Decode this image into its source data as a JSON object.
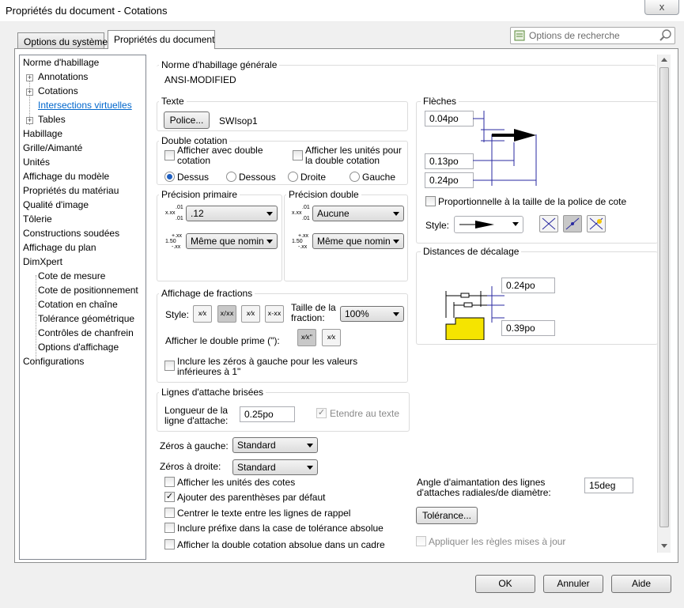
{
  "window": {
    "title": "Propriétés du document - Cotations",
    "close_glyph": "x"
  },
  "tabs": [
    {
      "label": "Options du système"
    },
    {
      "label": "Propriétés du document"
    }
  ],
  "search": {
    "placeholder": "Options de recherche"
  },
  "tree": {
    "items": [
      {
        "label": "Norme d'habillage"
      },
      {
        "label": "Annotations"
      },
      {
        "label": "Cotations"
      },
      {
        "label": "Intersections virtuelles"
      },
      {
        "label": "Tables"
      },
      {
        "label": "Habillage"
      },
      {
        "label": "Grille/Aimanté"
      },
      {
        "label": "Unités"
      },
      {
        "label": "Affichage du modèle"
      },
      {
        "label": "Propriétés du matériau"
      },
      {
        "label": "Qualité d'image"
      },
      {
        "label": "Tôlerie"
      },
      {
        "label": "Constructions soudées"
      },
      {
        "label": "Affichage du plan"
      },
      {
        "label": "DimXpert"
      },
      {
        "label": "Cote de mesure"
      },
      {
        "label": "Cote de positionnement"
      },
      {
        "label": "Cotation en chaîne"
      },
      {
        "label": "Tolérance géométrique"
      },
      {
        "label": "Contrôles de chanfrein"
      },
      {
        "label": "Options d'affichage"
      },
      {
        "label": "Configurations"
      }
    ],
    "expander_glyph": "+"
  },
  "norme": {
    "caption": "Norme d'habillage générale",
    "value": "ANSI-MODIFIED"
  },
  "texte": {
    "caption": "Texte",
    "font_button": "Police...",
    "font_name": "SWIsop1"
  },
  "double_cotation": {
    "caption": "Double cotation",
    "cb_double": "Afficher avec double cotation",
    "cb_units": "Afficher les unités pour la double cotation",
    "radios": [
      "Dessus",
      "Dessous",
      "Droite",
      "Gauche"
    ]
  },
  "precision_primaire": {
    "caption": "Précision primaire",
    "value1": ".12",
    "value2": "Même que nomin",
    "icon1": [
      "x.xx",
      ".01",
      ".01"
    ],
    "icon2": [
      "1.50",
      "+.xx",
      "-.xx"
    ]
  },
  "precision_double": {
    "caption": "Précision double",
    "value1": "Aucune",
    "value2": "Même que nomin",
    "icon1": [
      "x.xx",
      ".01",
      ".01"
    ],
    "icon2": [
      "1.50",
      "+.xx",
      "-.xx"
    ]
  },
  "fleches": {
    "caption": "Flèches",
    "v1": "0.04po",
    "v2": "0.13po",
    "v3": "0.24po",
    "cb_prop": "Proportionnelle à la taille de la police de cote",
    "style_label": "Style:"
  },
  "decalage": {
    "caption": "Distances de décalage",
    "v1": "0.24po",
    "v2": "0.39po"
  },
  "fractions": {
    "caption": "Affichage de fractions",
    "style_label": "Style:",
    "style_glyphs": [
      "x⁄x",
      "x/xx",
      "x⁄x",
      "x-xx"
    ],
    "size_label": "Taille de la fraction:",
    "size_value": "100%",
    "prime_label": "Afficher le double prime (\"):",
    "prime_glyphs": [
      "x⁄x\"",
      "x⁄x"
    ],
    "cb_zeros": "Inclure les zéros à gauche pour les valeurs inférieures à 1\""
  },
  "lignes": {
    "caption": "Lignes d'attache brisées",
    "length_label": "Longueur de la ligne d'attache:",
    "length_value": "0.25po",
    "cb_extend": "Etendre au texte"
  },
  "zeros": {
    "left_label": "Zéros à gauche:",
    "left_value": "Standard",
    "right_label": "Zéros à droite:",
    "right_value": "Standard"
  },
  "options": [
    {
      "label": "Afficher les unités des cotes",
      "checked": false
    },
    {
      "label": "Ajouter des parenthèses par défaut",
      "checked": true
    },
    {
      "label": "Centrer le texte entre les lignes de rappel",
      "checked": false
    },
    {
      "label": "Inclure préfixe dans la case de tolérance absolue",
      "checked": false
    },
    {
      "label": "Afficher la double cotation absolue dans un cadre",
      "checked": false
    }
  ],
  "angle": {
    "label": "Angle d'aimantation des lignes d'attaches radiales/de diamètre:",
    "value": "15deg"
  },
  "tolerance_button": "Tolérance...",
  "apply_rules": "Appliquer les règles mises à jour",
  "footer": {
    "ok": "OK",
    "cancel": "Annuler",
    "help": "Aide"
  },
  "check_glyph": "✓",
  "colors": {
    "accent": "#1f5fc0",
    "dim_lines": "#2a2aa0",
    "part_fill": "#f5e400"
  }
}
